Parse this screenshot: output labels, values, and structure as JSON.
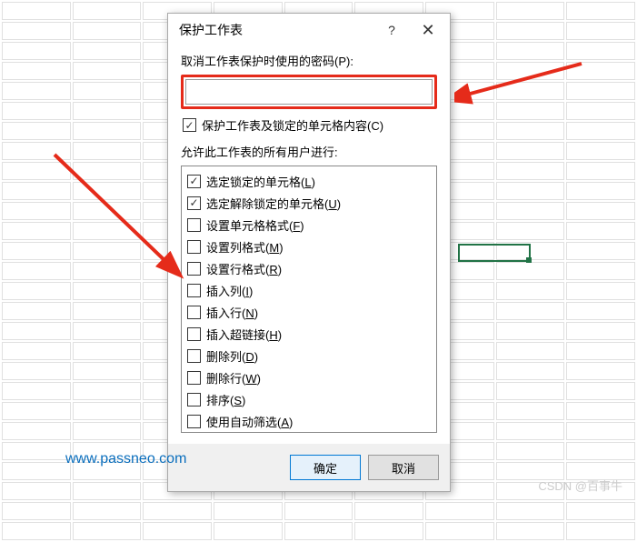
{
  "dialog": {
    "title": "保护工作表",
    "help": "?",
    "close": "✕",
    "password_label": "取消工作表保护时使用的密码(P):",
    "password_value": "",
    "protect_structure_label": "保护工作表及锁定的单元格内容(C)",
    "protect_structure_checked": true,
    "permissions_label": "允许此工作表的所有用户进行:",
    "permissions": [
      {
        "label": "选定锁定的单元格(L)",
        "checked": true
      },
      {
        "label": "选定解除锁定的单元格(U)",
        "checked": true
      },
      {
        "label": "设置单元格格式(F)",
        "checked": false
      },
      {
        "label": "设置列格式(M)",
        "checked": false
      },
      {
        "label": "设置行格式(R)",
        "checked": false
      },
      {
        "label": "插入列(I)",
        "checked": false
      },
      {
        "label": "插入行(N)",
        "checked": false
      },
      {
        "label": "插入超链接(H)",
        "checked": false
      },
      {
        "label": "删除列(D)",
        "checked": false
      },
      {
        "label": "删除行(W)",
        "checked": false
      },
      {
        "label": "排序(S)",
        "checked": false
      },
      {
        "label": "使用自动筛选(A)",
        "checked": false
      }
    ],
    "ok_label": "确定",
    "cancel_label": "取消"
  },
  "watermarks": {
    "url": "www.passneo.com",
    "csdn": "CSDN @百事牛"
  },
  "annotations": {
    "arrow1_color": "#e52b1a",
    "arrow2_color": "#e52b1a",
    "highlight_color": "#e52b1a"
  }
}
